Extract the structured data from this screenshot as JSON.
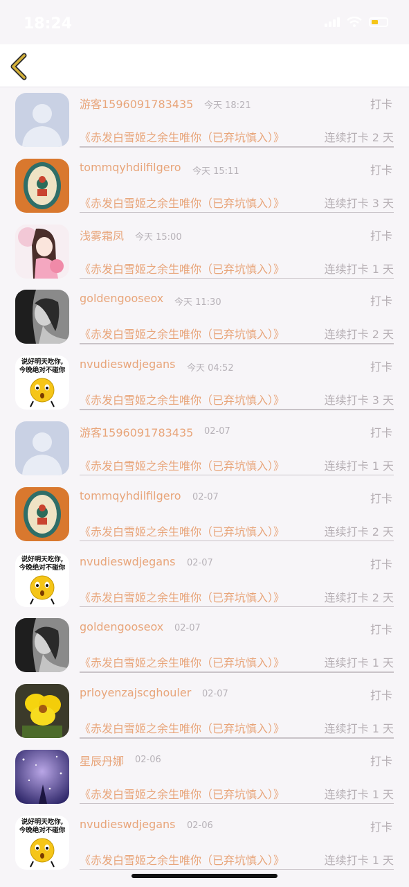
{
  "status_bar": {
    "time": "18:24"
  },
  "colors": {
    "accent": "#e8a57a",
    "muted": "#b5aeb3",
    "background": "#f7f5f8"
  },
  "checkins": [
    {
      "username": "游客1596091783435",
      "time": "今天 18:21",
      "action": "打卡",
      "book": "《赤发白雪姬之余生唯你（已弃坑慎入）》",
      "streak": "连续打卡 2 天",
      "avatar": "default-avatar"
    },
    {
      "username": "tommqyhdilfilgero",
      "time": "今天 15:11",
      "action": "打卡",
      "book": "《赤发白雪姬之余生唯你（已弃坑慎入）》",
      "streak": "连续打卡 3 天",
      "avatar": "alice-frame-avatar"
    },
    {
      "username": "浅雾霜凤",
      "time": "今天 15:00",
      "action": "打卡",
      "book": "《赤发白雪姬之余生唯你（已弃坑慎入）》",
      "streak": "连续打卡 1 天",
      "avatar": "anime-girl-avatar"
    },
    {
      "username": "goldengooseox",
      "time": "今天 11:30",
      "action": "打卡",
      "book": "《赤发白雪姬之余生唯你（已弃坑慎入）》",
      "streak": "连续打卡 2 天",
      "avatar": "bw-portrait-avatar"
    },
    {
      "username": "nvudieswdjegans",
      "time": "今天 04:52",
      "action": "打卡",
      "book": "《赤发白雪姬之余生唯你（已弃坑慎入）》",
      "streak": "连续打卡 3 天",
      "avatar": "emoji-meme-avatar",
      "avatar_text": [
        "说好明天吃你,",
        "今晚绝对不碰你"
      ]
    },
    {
      "username": "游客1596091783435",
      "time": "02-07",
      "action": "打卡",
      "book": "《赤发白雪姬之余生唯你（已弃坑慎入）》",
      "streak": "连续打卡 1 天",
      "avatar": "default-avatar"
    },
    {
      "username": "tommqyhdilfilgero",
      "time": "02-07",
      "action": "打卡",
      "book": "《赤发白雪姬之余生唯你（已弃坑慎入）》",
      "streak": "连续打卡 2 天",
      "avatar": "alice-frame-avatar"
    },
    {
      "username": "nvudieswdjegans",
      "time": "02-07",
      "action": "打卡",
      "book": "《赤发白雪姬之余生唯你（已弃坑慎入）》",
      "streak": "连续打卡 2 天",
      "avatar": "emoji-meme-avatar",
      "avatar_text": [
        "说好明天吃你,",
        "今晚绝对不碰你"
      ]
    },
    {
      "username": "goldengooseox",
      "time": "02-07",
      "action": "打卡",
      "book": "《赤发白雪姬之余生唯你（已弃坑慎入）》",
      "streak": "连续打卡 1 天",
      "avatar": "bw-portrait-avatar"
    },
    {
      "username": "prloyenzajscghouler",
      "time": "02-07",
      "action": "打卡",
      "book": "《赤发白雪姬之余生唯你（已弃坑慎入）》",
      "streak": "连续打卡 1 天",
      "avatar": "yellow-flower-avatar"
    },
    {
      "username": "星辰丹娜",
      "time": "02-06",
      "action": "打卡",
      "book": "《赤发白雪姬之余生唯你（已弃坑慎入）》",
      "streak": "连续打卡 1 天",
      "avatar": "starry-night-avatar"
    },
    {
      "username": "nvudieswdjegans",
      "time": "02-06",
      "action": "打卡",
      "book": "《赤发白雪姬之余生唯你（已弃坑慎入）》",
      "streak": "连续打卡 1 天",
      "avatar": "emoji-meme-avatar",
      "avatar_text": [
        "说好明天吃你,",
        "今晚绝对不碰你"
      ]
    }
  ]
}
